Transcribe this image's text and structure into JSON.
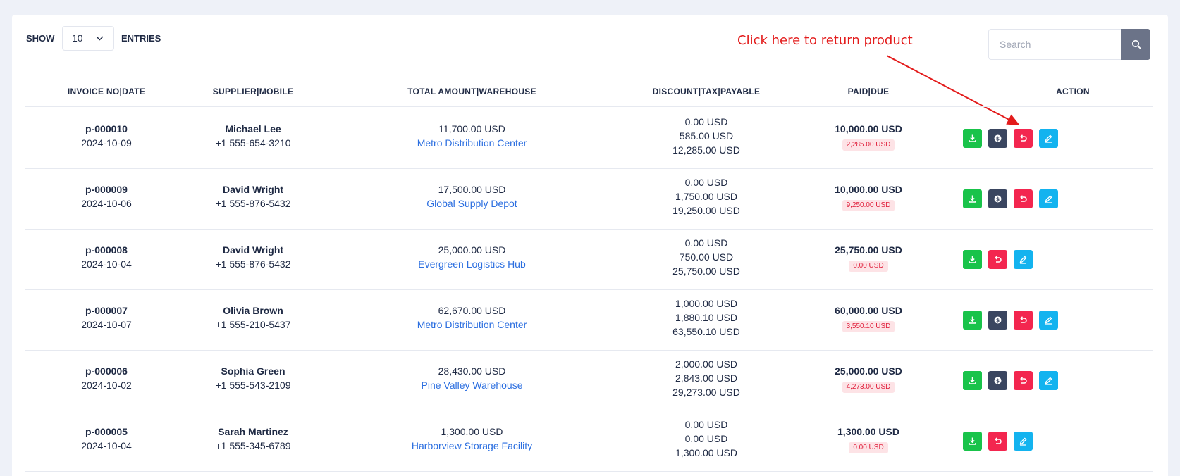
{
  "controls": {
    "show_label": "SHOW",
    "entries_value": "10",
    "entries_label": "ENTRIES",
    "search_placeholder": "Search"
  },
  "annotation": {
    "text": "Click here to return product",
    "color": "#e31b1b"
  },
  "table": {
    "headers": [
      "INVOICE NO|DATE",
      "SUPPLIER|MOBILE",
      "TOTAL AMOUNT|WAREHOUSE",
      "DISCOUNT|TAX|PAYABLE",
      "PAID|DUE",
      "ACTION"
    ],
    "rows": [
      {
        "invoice": "p-000010",
        "date": "2024-10-09",
        "supplier": "Michael Lee",
        "mobile": "+1 555-654-3210",
        "total": "11,700.00 USD",
        "warehouse": "Metro Distribution Center",
        "discount": "0.00 USD",
        "tax": "585.00 USD",
        "payable": "12,285.00 USD",
        "paid": "10,000.00 USD",
        "due": "2,285.00 USD",
        "actions": [
          "download-icon",
          "payment-icon",
          "return-icon",
          "edit-icon"
        ]
      },
      {
        "invoice": "p-000009",
        "date": "2024-10-06",
        "supplier": "David Wright",
        "mobile": "+1 555-876-5432",
        "total": "17,500.00 USD",
        "warehouse": "Global Supply Depot",
        "discount": "0.00 USD",
        "tax": "1,750.00 USD",
        "payable": "19,250.00 USD",
        "paid": "10,000.00 USD",
        "due": "9,250.00 USD",
        "actions": [
          "download-icon",
          "payment-icon",
          "return-icon",
          "edit-icon"
        ]
      },
      {
        "invoice": "p-000008",
        "date": "2024-10-04",
        "supplier": "David Wright",
        "mobile": "+1 555-876-5432",
        "total": "25,000.00 USD",
        "warehouse": "Evergreen Logistics Hub",
        "discount": "0.00 USD",
        "tax": "750.00 USD",
        "payable": "25,750.00 USD",
        "paid": "25,750.00 USD",
        "due": "0.00 USD",
        "actions": [
          "download-icon",
          "return-icon",
          "edit-icon"
        ]
      },
      {
        "invoice": "p-000007",
        "date": "2024-10-07",
        "supplier": "Olivia Brown",
        "mobile": "+1 555-210-5437",
        "total": "62,670.00 USD",
        "warehouse": "Metro Distribution Center",
        "discount": "1,000.00 USD",
        "tax": "1,880.10 USD",
        "payable": "63,550.10 USD",
        "paid": "60,000.00 USD",
        "due": "3,550.10 USD",
        "actions": [
          "download-icon",
          "payment-icon",
          "return-icon",
          "edit-icon"
        ]
      },
      {
        "invoice": "p-000006",
        "date": "2024-10-02",
        "supplier": "Sophia Green",
        "mobile": "+1 555-543-2109",
        "total": "28,430.00 USD",
        "warehouse": "Pine Valley Warehouse",
        "discount": "2,000.00 USD",
        "tax": "2,843.00 USD",
        "payable": "29,273.00 USD",
        "paid": "25,000.00 USD",
        "due": "4,273.00 USD",
        "actions": [
          "download-icon",
          "payment-icon",
          "return-icon",
          "edit-icon"
        ]
      },
      {
        "invoice": "p-000005",
        "date": "2024-10-04",
        "supplier": "Sarah Martinez",
        "mobile": "+1 555-345-6789",
        "total": "1,300.00 USD",
        "warehouse": "Harborview Storage Facility",
        "discount": "0.00 USD",
        "tax": "0.00 USD",
        "payable": "1,300.00 USD",
        "paid": "1,300.00 USD",
        "due": "0.00 USD",
        "actions": [
          "download-icon",
          "return-icon",
          "edit-icon"
        ]
      }
    ]
  },
  "colors": {
    "download": "#19c34a",
    "payment": "#3a4660",
    "return": "#f3264f",
    "edit": "#13b3ef",
    "link": "#2c6fe0"
  }
}
